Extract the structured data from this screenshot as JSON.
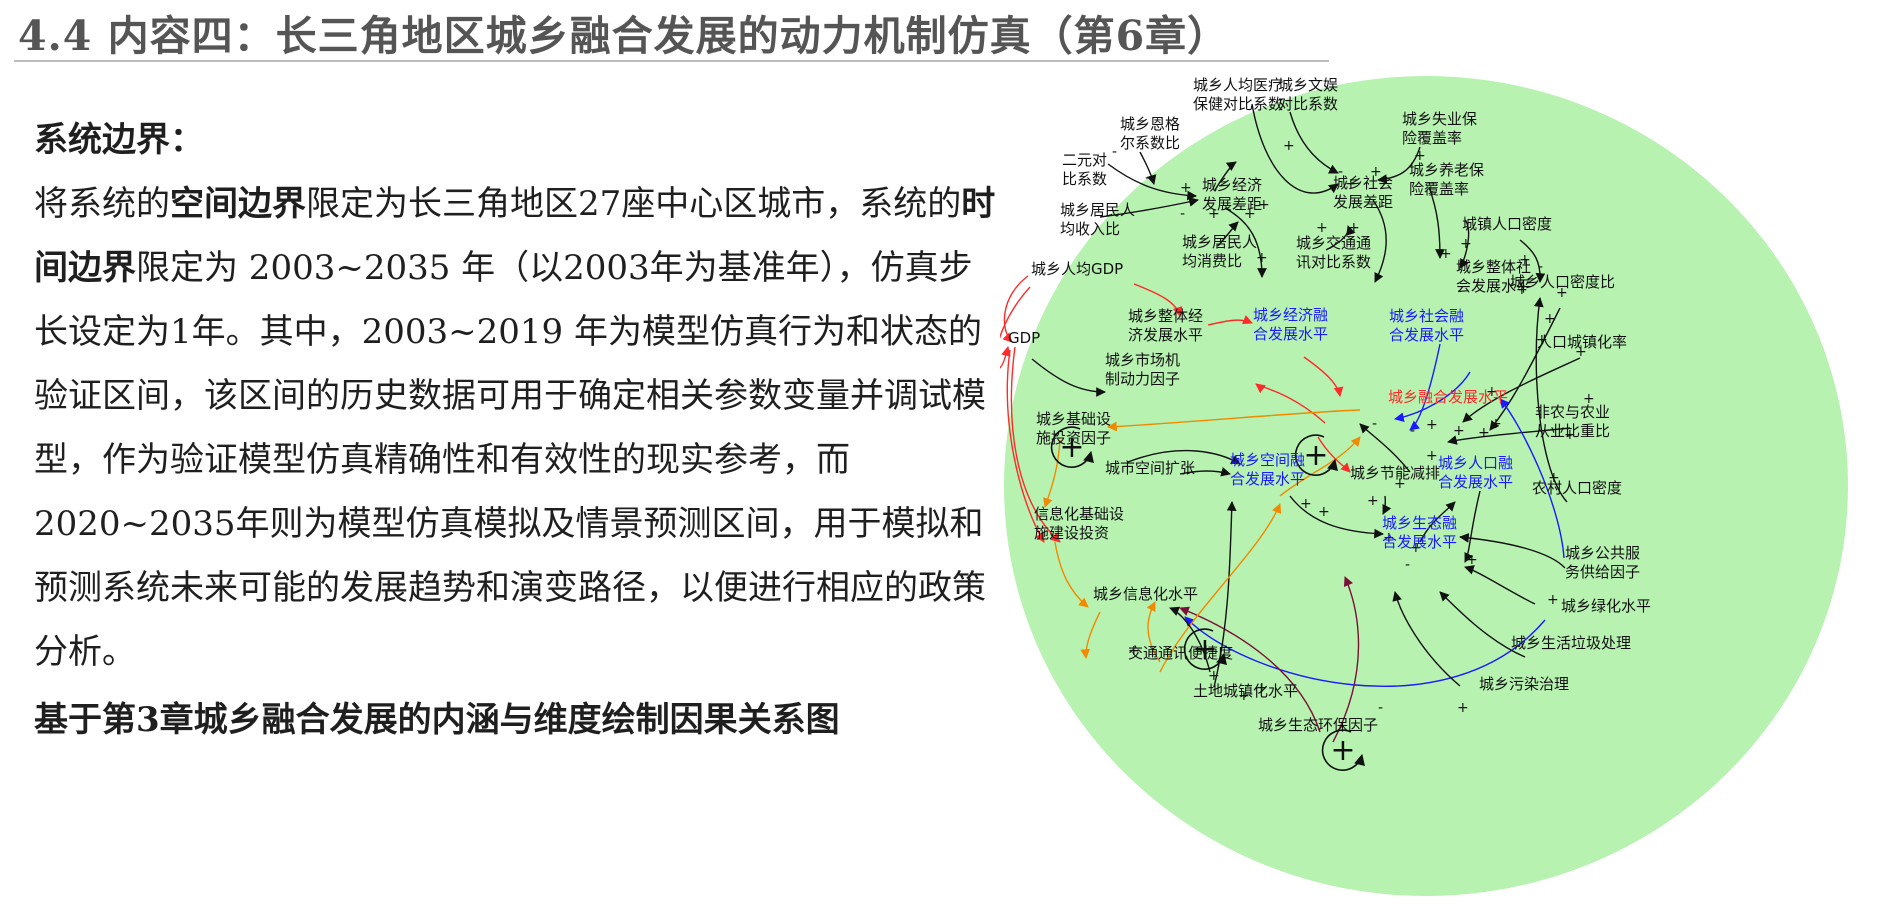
{
  "header": {
    "title": "4.4 内容四：长三角地区城乡融合发展的动力机制仿真（第6章）"
  },
  "body": {
    "heading": "系统边界：",
    "p1_pre": "将系统的",
    "p1_b1": "空间边界",
    "p1_mid": "限定为长三角地区27座中心区城市，系统的",
    "p1_b2": "时间边界",
    "p1_post": "限定为 2003~2035 年（以2003年为基准年），仿真步长设定为1年。其中，2003~2019 年为模型仿真行为和状态的验证区间，该区间的历史数据可用于确定相关参数变量并调试模型，作为验证模型仿真精确性和有效性的现实参考，而2020~2035年则为模型仿真模拟及情景预测区间，用于模拟和预测系统未来可能的发展趋势和演变路径，以便进行相应的政策分析。",
    "footer": "基于第3章城乡融合发展的内涵与维度绘制因果关系图"
  },
  "diagram": {
    "colors": {
      "background": "#b7f2b1",
      "black": "#111111",
      "blue": "#1a1aff",
      "red": "#ff2a2a",
      "orange": "#f08a00",
      "purple": "#7a1038",
      "core": "#ff2a2a"
    },
    "nodes": [
      {
        "id": "med",
        "lines": [
          "城乡人均医疗",
          "保健对比系数"
        ],
        "color": "black"
      },
      {
        "id": "cul",
        "lines": [
          "城乡文娱",
          "对比系数"
        ],
        "color": "black"
      },
      {
        "id": "engel",
        "lines": [
          "城乡恩格",
          "尔系数比"
        ],
        "color": "black"
      },
      {
        "id": "unemp",
        "lines": [
          "城乡失业保",
          "险覆盖率"
        ],
        "color": "black"
      },
      {
        "id": "dual",
        "lines": [
          "二元对",
          "比系数"
        ],
        "color": "black"
      },
      {
        "id": "econgap",
        "lines": [
          "城乡经济",
          "发展差距"
        ],
        "color": "black"
      },
      {
        "id": "socgap",
        "lines": [
          "城乡社会",
          "发展差距"
        ],
        "color": "black"
      },
      {
        "id": "pension",
        "lines": [
          "城乡养老保",
          "险覆盖率"
        ],
        "color": "black"
      },
      {
        "id": "income",
        "lines": [
          "城乡居民人",
          "均收入比"
        ],
        "color": "black"
      },
      {
        "id": "popden",
        "lines": [
          "城镇人口密度"
        ],
        "color": "black"
      },
      {
        "id": "consume",
        "lines": [
          "城乡居民人",
          "均消费比"
        ],
        "color": "black"
      },
      {
        "id": "traffic",
        "lines": [
          "城乡交通通",
          "讯对比系数"
        ],
        "color": "black"
      },
      {
        "id": "gdppc",
        "lines": [
          "城乡人均GDP"
        ],
        "color": "black"
      },
      {
        "id": "socall",
        "lines": [
          "城乡整体社",
          "会发展水平"
        ],
        "color": "black"
      },
      {
        "id": "denratio",
        "lines": [
          "城乡人口密度比"
        ],
        "color": "black"
      },
      {
        "id": "econall",
        "lines": [
          "城乡整体经",
          "济发展水平"
        ],
        "color": "black"
      },
      {
        "id": "econint",
        "lines": [
          "城乡经济融",
          "合发展水平"
        ],
        "color": "blue"
      },
      {
        "id": "socint",
        "lines": [
          "城乡社会融",
          "合发展水平"
        ],
        "color": "blue"
      },
      {
        "id": "gdp",
        "lines": [
          "GDP"
        ],
        "color": "black"
      },
      {
        "id": "urbanrate",
        "lines": [
          "人口城镇化率"
        ],
        "color": "black"
      },
      {
        "id": "market",
        "lines": [
          "城乡市场机",
          "制动力因子"
        ],
        "color": "black"
      },
      {
        "id": "core",
        "lines": [
          "城乡融合发展水平"
        ],
        "color": "core"
      },
      {
        "id": "infra",
        "lines": [
          "城乡基础设",
          "施投资因子"
        ],
        "color": "black"
      },
      {
        "id": "nonagri",
        "lines": [
          "非农与农业",
          "从业比重比"
        ],
        "color": "black"
      },
      {
        "id": "expand",
        "lines": [
          "城市空间扩张"
        ],
        "color": "black"
      },
      {
        "id": "spaint",
        "lines": [
          "城乡空间融",
          "合发展水平"
        ],
        "color": "blue"
      },
      {
        "id": "energy",
        "lines": [
          "城乡节能减排"
        ],
        "color": "black"
      },
      {
        "id": "popint",
        "lines": [
          "城乡人口融",
          "合发展水平"
        ],
        "color": "blue"
      },
      {
        "id": "rural",
        "lines": [
          "农村人口密度"
        ],
        "color": "black"
      },
      {
        "id": "infoinv",
        "lines": [
          "信息化基础设",
          "施建设投资"
        ],
        "color": "black"
      },
      {
        "id": "ecoint",
        "lines": [
          "城乡生态融",
          "合发展水平"
        ],
        "color": "blue"
      },
      {
        "id": "pubsvc",
        "lines": [
          "城乡公共服",
          "务供给因子"
        ],
        "color": "black"
      },
      {
        "id": "info",
        "lines": [
          "城乡信息化水平"
        ],
        "color": "black"
      },
      {
        "id": "green",
        "lines": [
          "城乡绿化水平"
        ],
        "color": "black"
      },
      {
        "id": "conv",
        "lines": [
          "交通通讯便捷度"
        ],
        "color": "black"
      },
      {
        "id": "garbage",
        "lines": [
          "城乡生活垃圾处理"
        ],
        "color": "black"
      },
      {
        "id": "land",
        "lines": [
          "土地城镇化水平"
        ],
        "color": "black"
      },
      {
        "id": "pollute",
        "lines": [
          "城乡污染治理"
        ],
        "color": "black"
      },
      {
        "id": "ecoenv",
        "lines": [
          "城乡生态环保因子"
        ],
        "color": "black"
      }
    ],
    "signs": [
      "+",
      "-",
      "-",
      "+",
      "-",
      "+",
      "+",
      "+",
      "+",
      "-",
      "+",
      "+",
      "+",
      "+",
      "+",
      "+",
      "+",
      "+",
      "-",
      "+",
      "+",
      "+",
      "+",
      "+",
      "+",
      "+",
      "+",
      "+",
      "+",
      "+",
      "+",
      "-",
      "+",
      "+",
      "-",
      "+",
      "+",
      "+",
      "+",
      "+",
      "+",
      "-",
      "+",
      "+",
      "+",
      "-",
      "+",
      "+",
      "+",
      "+"
    ],
    "loops": [
      "+",
      "+",
      "+",
      "+"
    ]
  }
}
